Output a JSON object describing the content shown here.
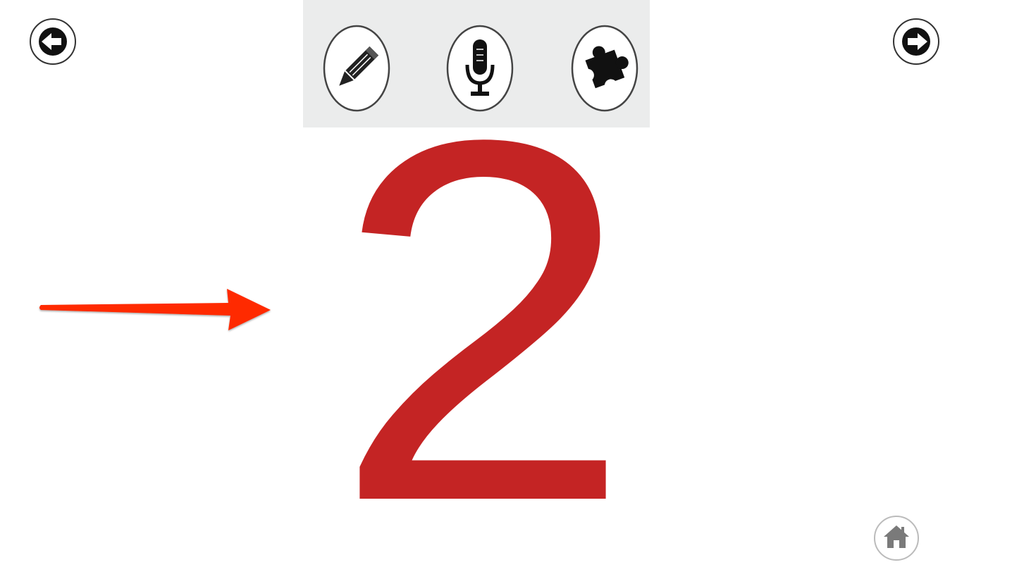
{
  "screen": {
    "digit": "2",
    "digit_color": "#c42424"
  },
  "navigation": {
    "prev_icon": "arrow-left-icon",
    "next_icon": "arrow-right-icon",
    "home_icon": "home-icon"
  },
  "toolbar": {
    "background": "#ebecec",
    "tools": [
      {
        "icon": "pencil-icon"
      },
      {
        "icon": "microphone-icon"
      },
      {
        "icon": "puzzle-icon"
      }
    ]
  },
  "annotation": {
    "arrow_color": "#ff2a00",
    "icon": "pointer-arrow-icon"
  }
}
